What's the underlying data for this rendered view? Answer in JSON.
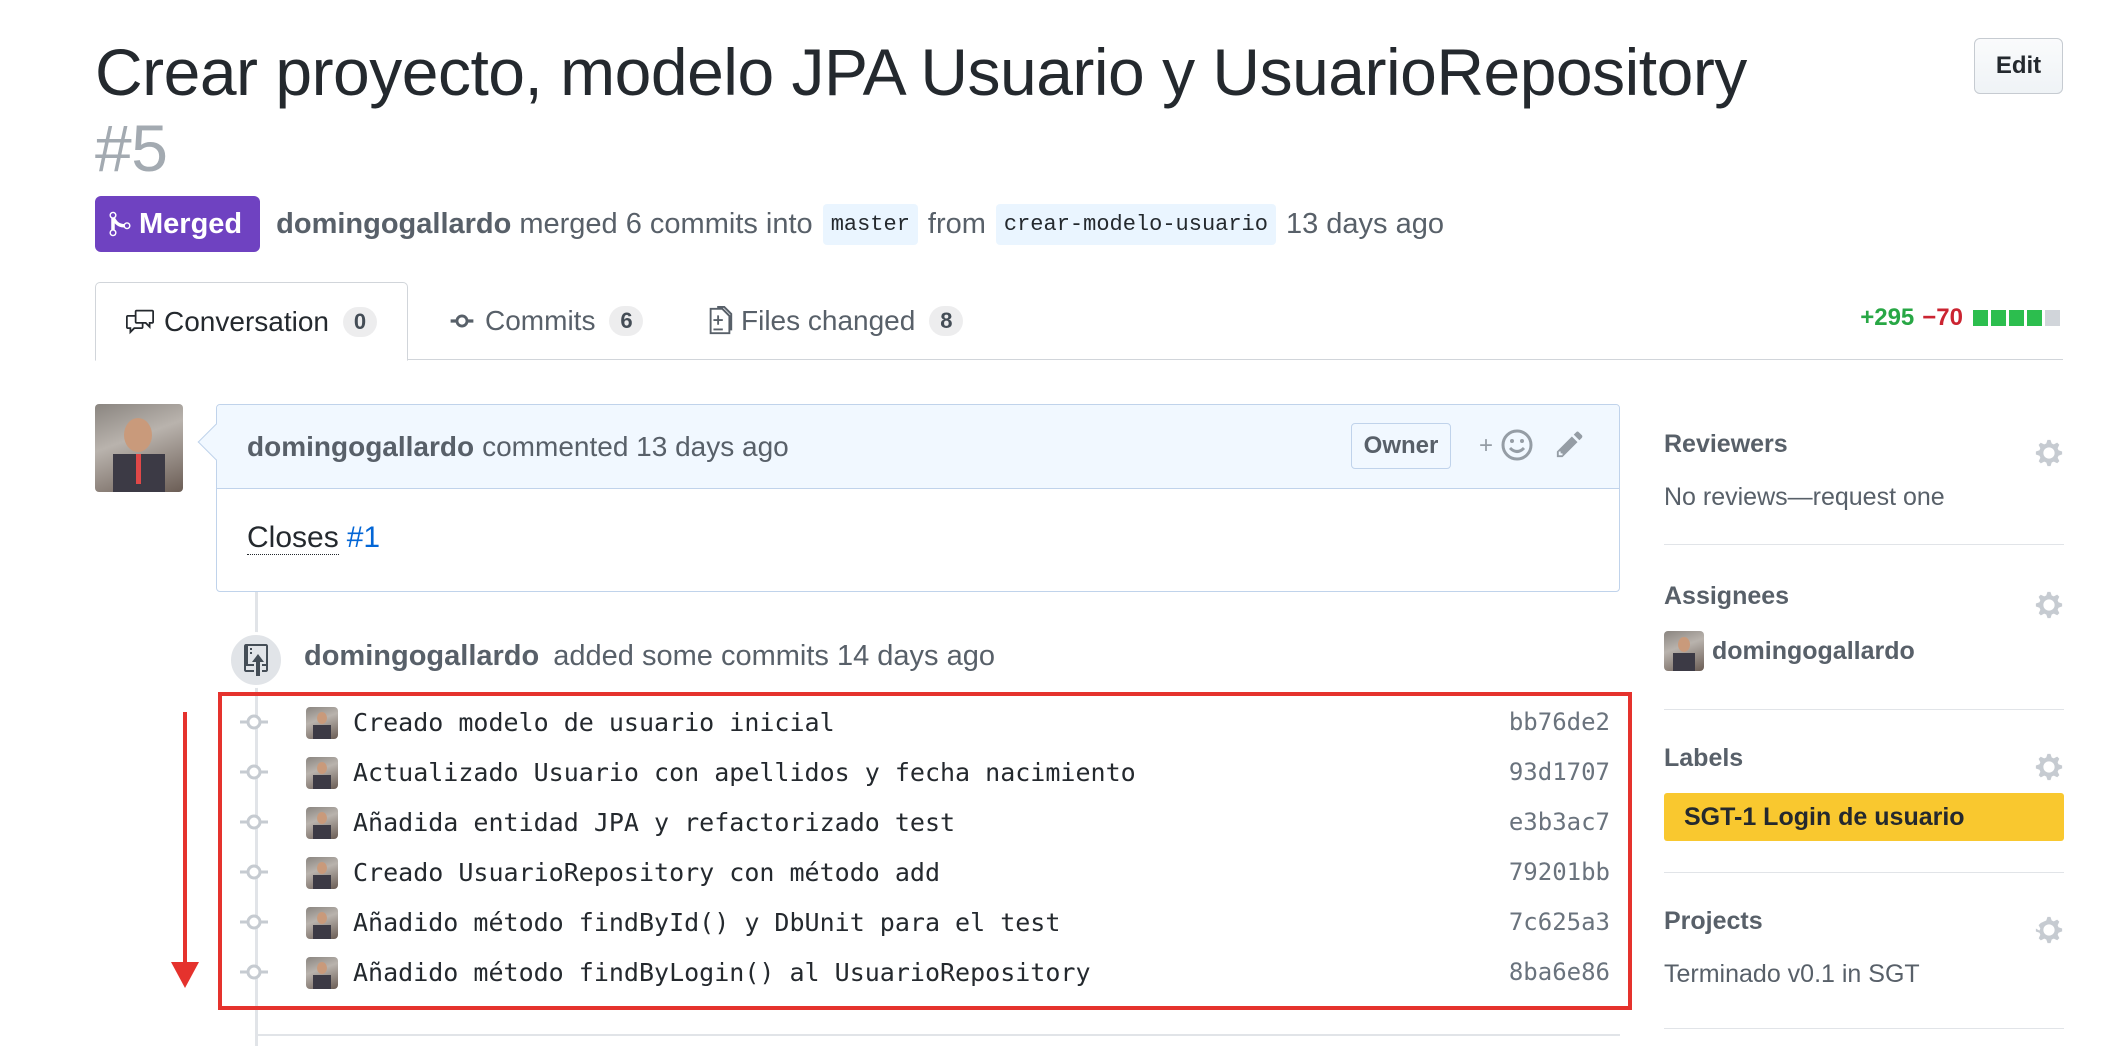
{
  "pr": {
    "title": "Crear proyecto, modelo JPA Usuario y UsuarioRepository",
    "number": "#5",
    "state": "Merged",
    "author": "domingogallardo",
    "merge_text": "merged 6 commits into",
    "base_branch": "master",
    "from_text": "from",
    "head_branch": "crear-modelo-usuario",
    "time": "13 days ago",
    "edit_label": "Edit",
    "state_color": "#6f42c1"
  },
  "tabs": [
    {
      "label": "Conversation",
      "count": "0",
      "icon": "comment-discussion-icon"
    },
    {
      "label": "Commits",
      "count": "6",
      "icon": "git-commit-icon"
    },
    {
      "label": "Files changed",
      "count": "8",
      "icon": "file-diff-icon"
    }
  ],
  "diffstat": {
    "additions": "+295",
    "deletions": "−70",
    "add_color": "#28a745",
    "del_color": "#cb2431"
  },
  "comment": {
    "author": "domingogallardo",
    "action": "commented 13 days ago",
    "badge": "Owner",
    "body_prefix": "Closes",
    "body_link": "#1",
    "react_plus": "+"
  },
  "push_event": {
    "author": "domingogallardo",
    "text": "added some commits 14 days ago"
  },
  "commits": [
    {
      "message": "Creado modelo de usuario inicial",
      "sha": "bb76de2"
    },
    {
      "message": "Actualizado Usuario con apellidos y fecha nacimiento",
      "sha": "93d1707"
    },
    {
      "message": "Añadida entidad JPA y refactorizado test",
      "sha": "e3b3ac7"
    },
    {
      "message": "Creado UsuarioRepository con método add",
      "sha": "79201bb"
    },
    {
      "message": "Añadido método findById() y DbUnit para el test",
      "sha": "7c625a3"
    },
    {
      "message": "Añadido método findByLogin() al UsuarioRepository",
      "sha": "8ba6e86"
    }
  ],
  "sidebar": {
    "reviewers": {
      "title": "Reviewers",
      "value": "No reviews—request one"
    },
    "assignees": {
      "title": "Assignees",
      "value": "domingogallardo"
    },
    "labels": {
      "title": "Labels",
      "value": "SGT-1 Login de usuario",
      "color": "#f9c82f"
    },
    "projects": {
      "title": "Projects",
      "value": "Terminado v0.1 in SGT"
    }
  },
  "annotation": {
    "box_color": "#e5322d"
  }
}
